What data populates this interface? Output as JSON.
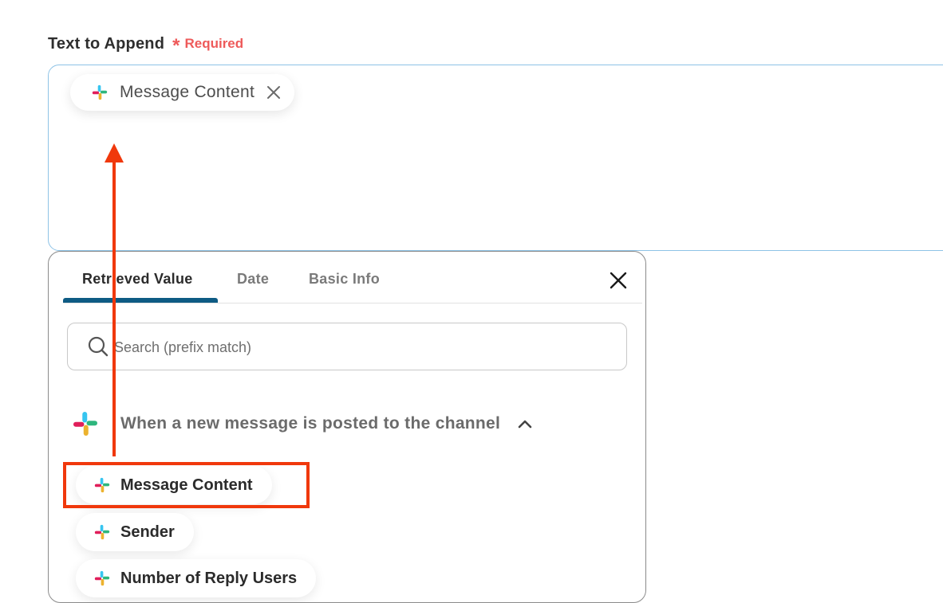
{
  "field": {
    "label": "Text to Append",
    "required_mark": "*",
    "required_text": "Required"
  },
  "chip": {
    "label": "Message Content",
    "icon": "slack-icon"
  },
  "panel": {
    "tabs": [
      {
        "label": "Retrieved Value",
        "active": true
      },
      {
        "label": "Date",
        "active": false
      },
      {
        "label": "Basic Info",
        "active": false
      }
    ],
    "search": {
      "placeholder": "Search (prefix match)",
      "value": ""
    },
    "group": {
      "title": "When a new message is posted to the channel",
      "expanded": true
    },
    "items": [
      {
        "label": "Message Content"
      },
      {
        "label": "Sender"
      },
      {
        "label": "Number of Reply Users"
      }
    ]
  },
  "colors": {
    "accent": "#0e5b84",
    "required": "#ee5a5a",
    "annotation": "#f0380c",
    "field_border": "#8ec3e6"
  }
}
